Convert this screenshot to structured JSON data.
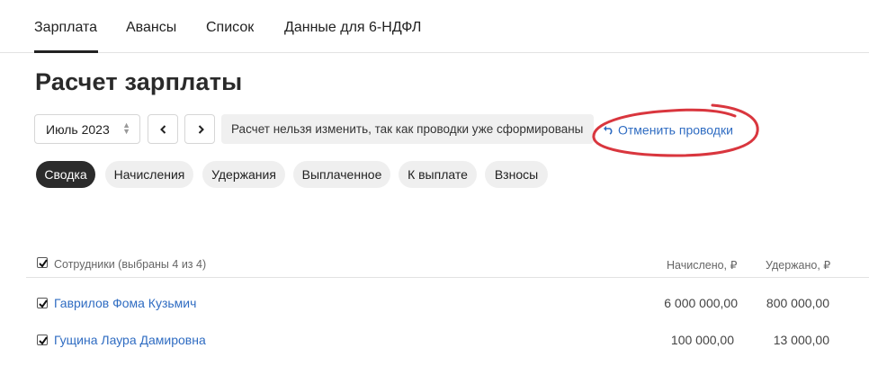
{
  "tabs": [
    "Зарплата",
    "Авансы",
    "Список",
    "Данные для 6-НДФЛ"
  ],
  "page_title": "Расчет зарплаты",
  "month_select": {
    "value": "Июль 2023"
  },
  "notice": {
    "text": "Расчет нельзя изменить, так как проводки уже сформированы"
  },
  "cancel_link": {
    "label": "Отменить проводки"
  },
  "filter_chips": [
    "Сводка",
    "Начисления",
    "Удержания",
    "Выплаченное",
    "К выплате",
    "Взносы"
  ],
  "table": {
    "headers": {
      "employees": "Сотрудники (выбраны 4 из 4)",
      "accrued": "Начислено, ₽",
      "withheld": "Удержано, ₽"
    },
    "rows": [
      {
        "name": "Гаврилов Фома Кузьмич",
        "accrued": "6 000 000,00",
        "withheld": "800 000,00",
        "checked": true
      },
      {
        "name": "Гущина Лаура Дамировна",
        "accrued": "100 000,00",
        "withheld": "13 000,00",
        "checked": true
      }
    ]
  },
  "colors": {
    "link": "#2f6cc2",
    "active_chip": "#2b2b2b",
    "annotation": "#d9363e"
  }
}
